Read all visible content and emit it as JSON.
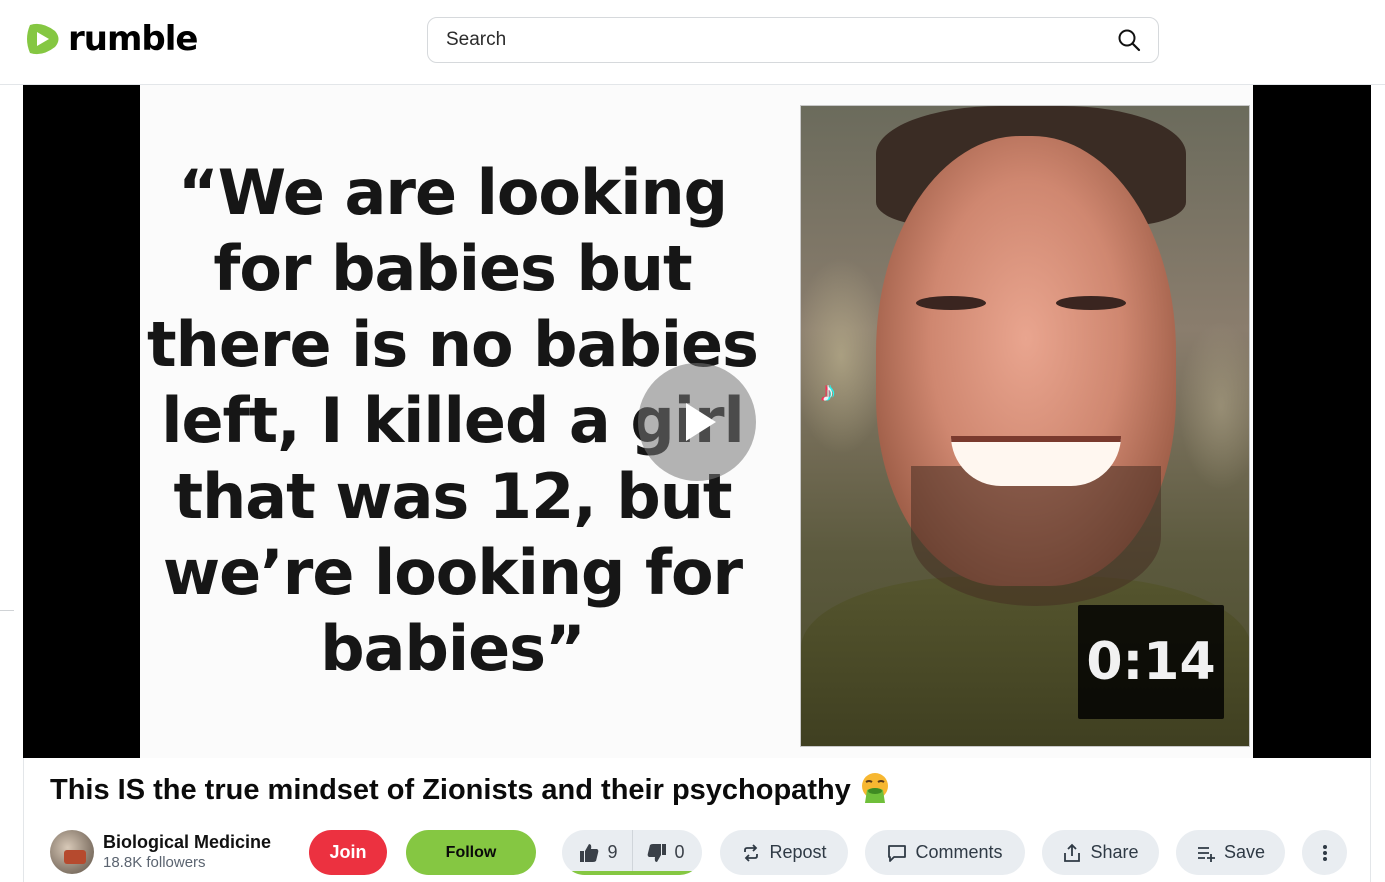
{
  "header": {
    "logo_text": "rumble",
    "logo_icon": "rumble-play-icon",
    "search_placeholder": "Search",
    "search_icon": "search-icon"
  },
  "player": {
    "quote": "“We are looking for babies but there is no babies left, I killed a girl that was 12, but we’re looking for babies”",
    "duration": "0:14",
    "play_icon": "play-icon",
    "watermark_icon": "tiktok-icon"
  },
  "video": {
    "title": "This IS the true mindset of Zionists and their psychopathy",
    "title_emoji": "vomiting-face-emoji"
  },
  "channel": {
    "name": "Biological Medicine",
    "followers": "18.8K followers"
  },
  "actions": {
    "join": "Join",
    "follow": "Follow",
    "likes": "9",
    "dislikes": "0",
    "repost": "Repost",
    "comments": "Comments",
    "share": "Share",
    "save": "Save"
  },
  "colors": {
    "brand_green": "#85c742",
    "join_red": "#ec3140",
    "pill_bg": "#e9edf1"
  }
}
